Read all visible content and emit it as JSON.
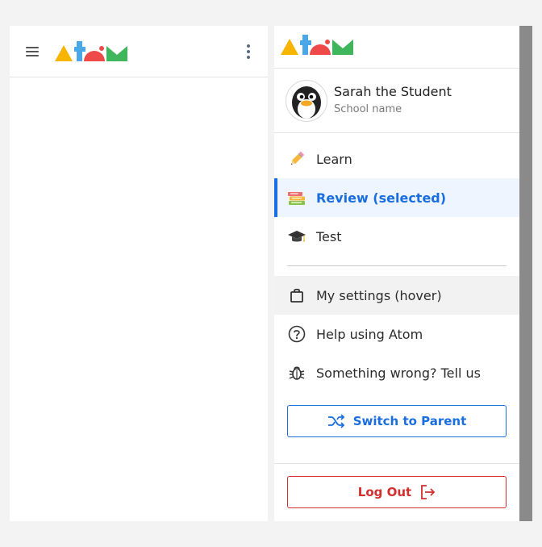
{
  "header": {
    "menu_icon": "hamburger-menu-icon",
    "logo": "Atom",
    "more_icon": "more-vertical-icon"
  },
  "drawer": {
    "logo": "Atom",
    "profile": {
      "name": "Sarah the Student",
      "school": "School name",
      "avatar_icon": "penguin-avatar"
    },
    "nav": {
      "learn": {
        "label": "Learn",
        "icon": "pencil-icon"
      },
      "review": {
        "label": "Review (selected)",
        "icon": "books-icon"
      },
      "test": {
        "label": "Test",
        "icon": "graduation-cap-icon"
      },
      "settings": {
        "label": "My settings (hover)",
        "icon": "bag-icon"
      },
      "help": {
        "label": "Help using Atom",
        "icon": "help-circle-icon"
      },
      "report": {
        "label": "Something wrong? Tell us",
        "icon": "bug-icon"
      }
    },
    "switch_button": "Switch to Parent",
    "logout_button": "Log Out"
  },
  "colors": {
    "accent_blue": "#1a6ee0",
    "danger_red": "#d32f2f",
    "logo_yellow": "#f7b500",
    "logo_blue": "#4aa8e8",
    "logo_red": "#ef4a4a",
    "logo_green": "#3fb55c"
  }
}
